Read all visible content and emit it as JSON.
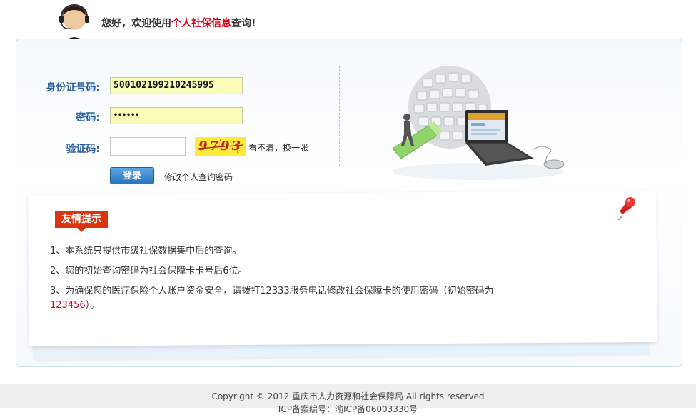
{
  "header": {
    "greeting_prefix": "您好，欢迎使用",
    "greeting_highlight": "个人社保信息",
    "greeting_suffix": "查询!"
  },
  "form": {
    "id_label": "身份证号码:",
    "id_value": "500102199210245995",
    "password_label": "密码:",
    "password_value": "••••••",
    "captcha_label": "验证码:",
    "captcha_value": "",
    "captcha_image_text": "9793",
    "refresh_label": "看不清，换一张",
    "login_label": "登录",
    "change_password_label": "修改个人查询密码"
  },
  "notice": {
    "title": "友情提示",
    "line1": "1、本系统只提供市级社保数据集中后的查询。",
    "line2": "2、您的初始查询密码为社会保障卡卡号后6位。",
    "line3": "3、为确保您的医疗保险个人账户资金安全，请拨打12333服务电话修改社会保障卡的使用密码（初始密码为",
    "line4_value": "123456",
    "line4_suffix": "）。"
  },
  "footer": {
    "copyright": "Copyright © 2012 重庆市人力资源和社会保障局 All rights reserved",
    "icp": "ICP备案编号：渝ICP备06003330号"
  },
  "colors": {
    "accent_red": "#d4001a",
    "label_blue": "#2a5f9e",
    "button_blue": "#2774c0",
    "tag_red": "#d9350f"
  }
}
